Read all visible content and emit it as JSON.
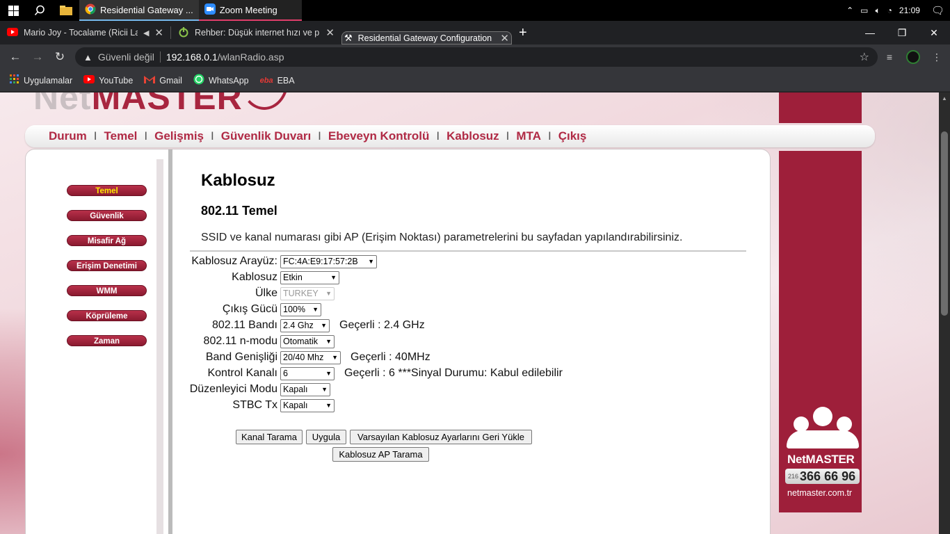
{
  "taskbar": {
    "apps": [
      {
        "label": "Residential Gateway ..."
      },
      {
        "label": "Zoom Meeting"
      }
    ],
    "time": "21:09"
  },
  "tabs": [
    {
      "title": "Mario Joy - Tocalame (Ricii La"
    },
    {
      "title": "Rehber: Düşük internet hızı ve pin"
    },
    {
      "title": "Residential Gateway Configuration"
    }
  ],
  "omnibox": {
    "security": "Güvenli değil",
    "host": "192.168.0.1",
    "path": "/wlanRadio.asp"
  },
  "bookmarks": [
    {
      "label": "Uygulamalar"
    },
    {
      "label": "YouTube"
    },
    {
      "label": "Gmail"
    },
    {
      "label": "WhatsApp"
    },
    {
      "label": "EBA"
    }
  ],
  "topmenu": [
    "Durum",
    "Temel",
    "Gelişmiş",
    "Güvenlik Duvarı",
    "Ebeveyn Kontrolü",
    "Kablosuz",
    "MTA",
    "Çıkış"
  ],
  "sidebar": [
    "Temel",
    "Güvenlik",
    "Misafir Ağ",
    "Erişim Denetimi",
    "WMM",
    "Köprüleme",
    "Zaman"
  ],
  "page": {
    "title": "Kablosuz",
    "subtitle": "802.11 Temel",
    "description": "SSID ve kanal numarası gibi AP (Erişim Noktası) parametrelerini bu sayfadan yapılandırabilirsiniz."
  },
  "form": [
    {
      "label": "Kablosuz Arayüz:",
      "value": "FC:4A:E9:17:57:2B",
      "current": ""
    },
    {
      "label": "Kablosuz",
      "value": "Etkin",
      "current": ""
    },
    {
      "label": "Ülke",
      "value": "TURKEY",
      "current": ""
    },
    {
      "label": "Çıkış Gücü",
      "value": "100%",
      "current": ""
    },
    {
      "label": "802.11 Bandı",
      "value": "2.4 Ghz",
      "current": "Geçerli :  2.4 GHz"
    },
    {
      "label": "802.11 n-modu",
      "value": "Otomatik",
      "current": ""
    },
    {
      "label": "Band Genişliği",
      "value": "20/40 Mhz",
      "current": "Geçerli :  40MHz"
    },
    {
      "label": "Kontrol Kanalı",
      "value": "6",
      "current": "Geçerli :  6 ***Sinyal Durumu: Kabul edilebilir"
    },
    {
      "label": "Düzenleyici Modu",
      "value": "Kapalı",
      "current": ""
    },
    {
      "label": "STBC Tx",
      "value": "Kapalı",
      "current": ""
    }
  ],
  "buttons": {
    "scan": "Kanal Tarama",
    "apply": "Uygula",
    "restore": "Varsayılan Kablosuz Ayarlarını Geri Yükle",
    "ap_scan": "Kablosuz AP Tarama"
  },
  "brand": {
    "name": "NetMASTER",
    "area": "216",
    "phone": "366 66 96",
    "url": "netmaster.com.tr",
    "logo_text": "NetMASTER"
  }
}
